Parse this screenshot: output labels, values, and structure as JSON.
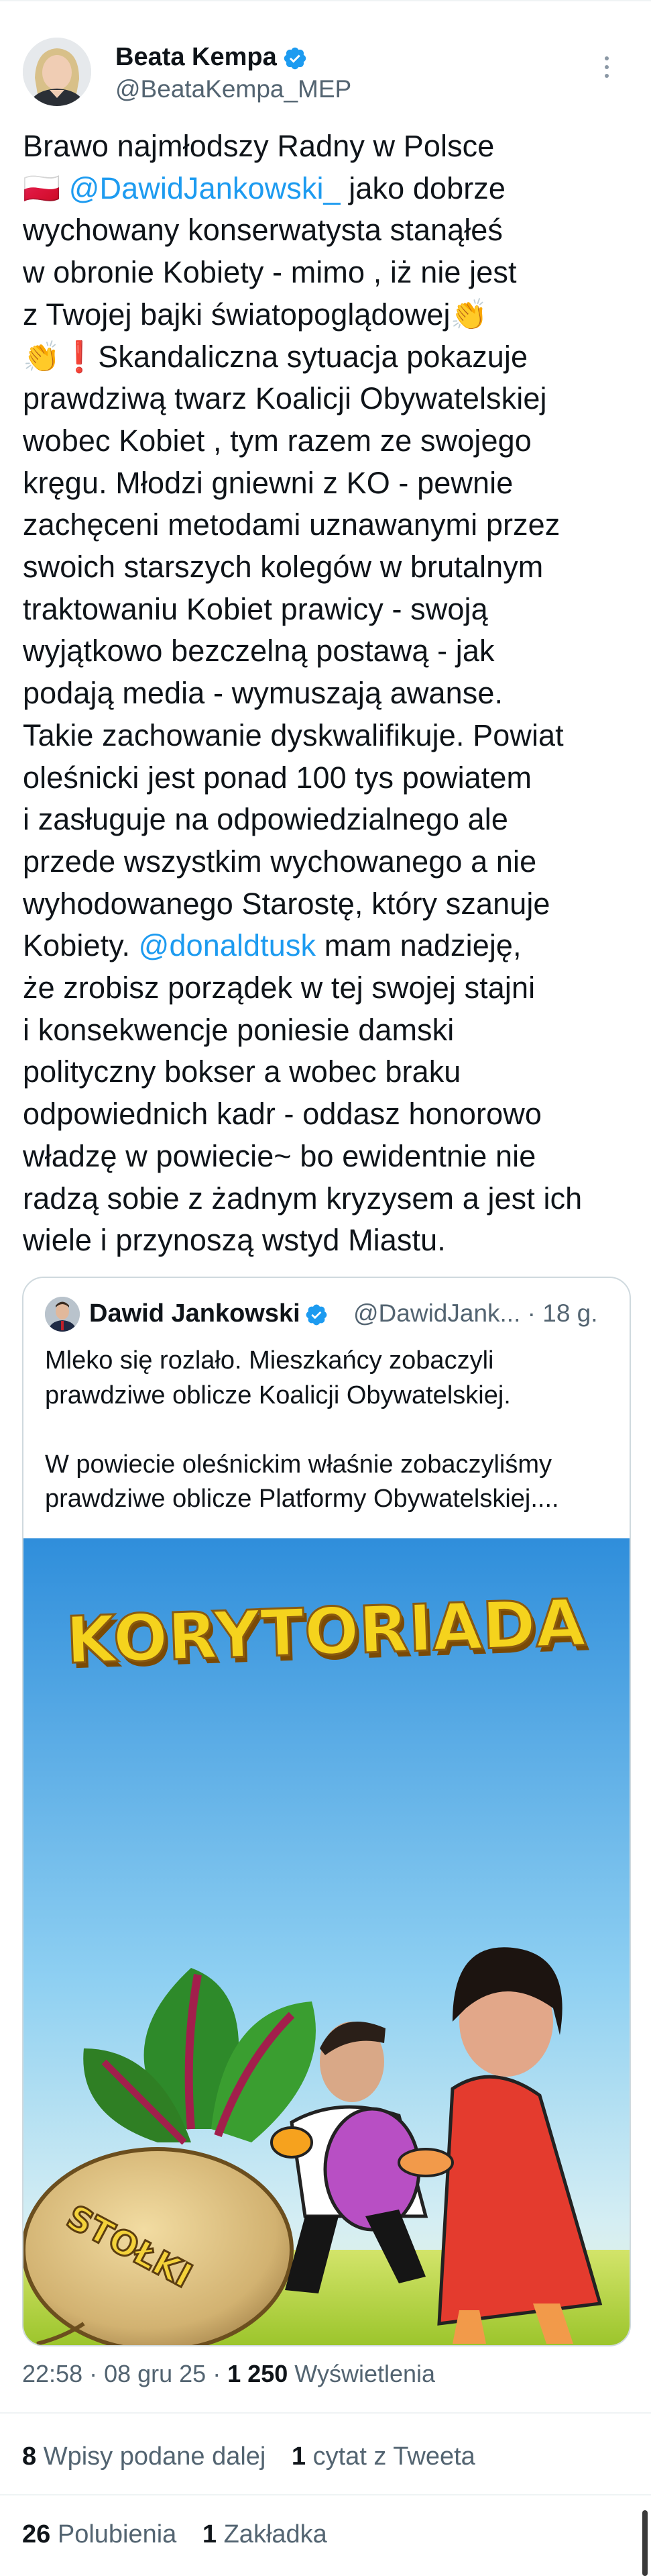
{
  "author": {
    "name": "Beata Kempa",
    "handle": "@BeataKempa_MEP"
  },
  "tweet": {
    "lines": [
      {
        "pre": "Brawo najmłodszy Radny w Polsce"
      },
      {
        "pre": "🇵🇱 ",
        "mention": "@DawidJankowski_",
        "post": "  jako dobrze"
      },
      {
        "pre": "wychowany konserwatysta stanąłeś"
      },
      {
        "pre": "w obronie Kobiety - mimo , iż nie jest"
      },
      {
        "pre": "z Twojej bajki światopoglądowej👏"
      },
      {
        "pre": "👏❗Skandaliczna sytuacja pokazuje"
      },
      {
        "pre": "prawdziwą twarz Koalicji Obywatelskiej"
      },
      {
        "pre": "wobec Kobiet , tym razem ze swojego"
      },
      {
        "pre": "kręgu. Młodzi gniewni z KO - pewnie"
      },
      {
        "pre": "zachęceni metodami uznawanymi przez"
      },
      {
        "pre": "swoich starszych kolegów w brutalnym"
      },
      {
        "pre": "traktowaniu Kobiet prawicy - swoją"
      },
      {
        "pre": "wyjątkowo bezczelną  postawą  - jak"
      },
      {
        "pre": "podają media - wymuszają awanse."
      },
      {
        "pre": "Takie zachowanie dyskwalifikuje. Powiat"
      },
      {
        "pre": "oleśnicki jest  ponad 100 tys  powiatem"
      },
      {
        "pre": "i zasługuje na odpowiedzialnego ale"
      },
      {
        "pre": "przede wszystkim wychowanego a nie"
      },
      {
        "pre": "wyhodowanego Starostę, który  szanuje"
      },
      {
        "pre": "Kobiety. ",
        "mention": "@donaldtusk",
        "post": "  mam nadzieję,"
      },
      {
        "pre": "że zrobisz porządek w tej swojej stajni"
      },
      {
        "pre": "i konsekwencje poniesie damski"
      },
      {
        "pre": "polityczny bokser  a wobec braku"
      },
      {
        "pre": "odpowiednich kadr - oddasz honorowo"
      },
      {
        "pre": "władzę w powiecie~ bo ewidentnie nie"
      },
      {
        "pre": "radzą sobie z żadnym kryzysem a jest ich"
      },
      {
        "pre": "wiele i przynoszą wstyd Miastu."
      }
    ]
  },
  "quoted": {
    "name": "Dawid Jankowski",
    "handle_time": "@DawidJank... · 18 g.",
    "lines": [
      "Mleko się rozlało. Mieszkańcy zobaczyli",
      "prawdziwe oblicze Koalicji Obywatelskiej.",
      "",
      "W powiecie oleśnickim właśnie zobaczyliśmy",
      "prawdziwe oblicze Platformy Obywatelskiej...."
    ],
    "image": {
      "title": "KORYTORIADA",
      "beet_label": "STOŁKI"
    }
  },
  "meta": {
    "timestamp": "22:58 · 08 gru 25 · ",
    "views_count": "1 250",
    "views_label": " Wyświetlenia"
  },
  "stats_row1": [
    {
      "count": "8",
      "label": "Wpisy podane dalej"
    },
    {
      "count": "1",
      "label": "cytat z Tweeta"
    }
  ],
  "stats_row2": [
    {
      "count": "26",
      "label": "Polubienia"
    },
    {
      "count": "1",
      "label": "Zakładka"
    }
  ],
  "colors": {
    "link": "#1d9bf0",
    "secondary_text": "#536471",
    "verified": "#1d9bf0",
    "title_yellow": "#f5d31d",
    "sky_top": "#2e8fd9",
    "grass": "#b6d23a"
  }
}
